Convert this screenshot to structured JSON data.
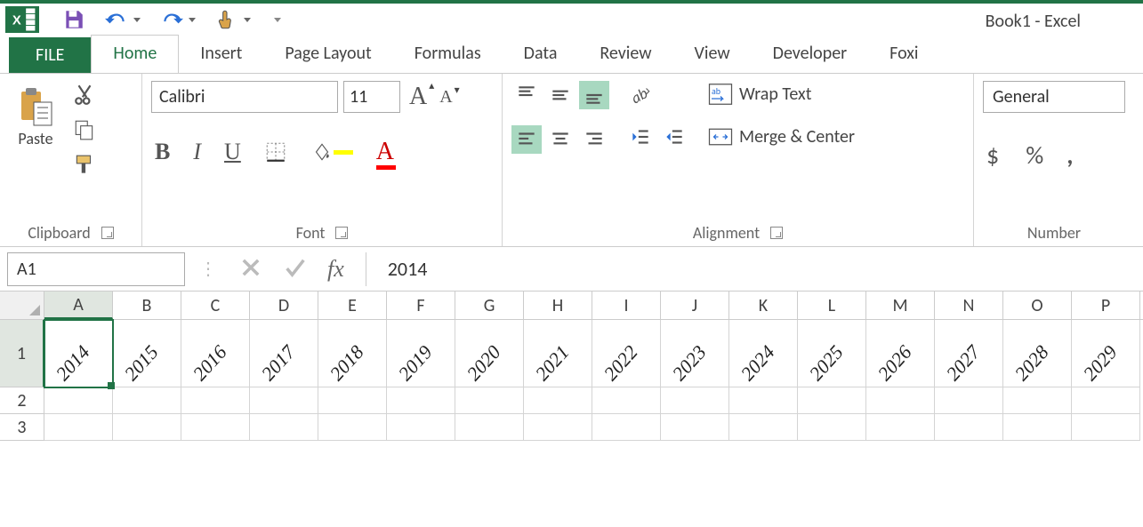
{
  "app_title": "Book1 - Excel",
  "tabs": {
    "file": "FILE",
    "home": "Home",
    "insert": "Insert",
    "page_layout": "Page Layout",
    "formulas": "Formulas",
    "data": "Data",
    "review": "Review",
    "view": "View",
    "developer": "Developer",
    "foxit": "Foxi"
  },
  "clipboard": {
    "paste": "Paste",
    "group": "Clipboard"
  },
  "font": {
    "name": "Calibri",
    "size": "11",
    "group": "Font"
  },
  "alignment": {
    "wrap": "Wrap Text",
    "merge": "Merge & Center",
    "group": "Alignment"
  },
  "number": {
    "format": "General",
    "dollar": "$",
    "percent": "%",
    "comma": ",",
    "group": "Number"
  },
  "namebox": "A1",
  "fx": "fx",
  "formula_value": "2014",
  "columns": [
    "A",
    "B",
    "C",
    "D",
    "E",
    "F",
    "G",
    "H",
    "I",
    "J",
    "K",
    "L",
    "M",
    "N",
    "O",
    "P"
  ],
  "rows": [
    "1",
    "2",
    "3"
  ],
  "row1_values": [
    "2014",
    "2015",
    "2016",
    "2017",
    "2018",
    "2019",
    "2020",
    "2021",
    "2022",
    "2023",
    "2024",
    "2025",
    "2026",
    "2027",
    "2028",
    "2029"
  ],
  "selected_cell": "A1"
}
